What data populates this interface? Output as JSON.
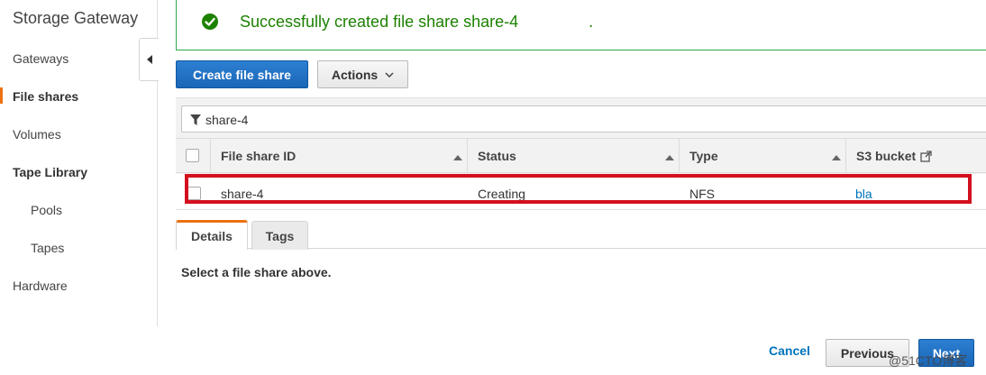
{
  "sidebar": {
    "title": "Storage Gateway",
    "items": [
      {
        "label": "Gateways"
      },
      {
        "label": "File shares"
      },
      {
        "label": "Volumes"
      },
      {
        "label": "Tape Library"
      },
      {
        "label": "Pools"
      },
      {
        "label": "Tapes"
      },
      {
        "label": "Hardware"
      }
    ],
    "active_item": "File shares"
  },
  "flash": {
    "message": "Successfully created file share share-4",
    "message_end": ".",
    "icon": "check-circle-icon",
    "color": "#1d8102"
  },
  "toolbar": {
    "create_label": "Create file share",
    "actions_label": "Actions"
  },
  "filter": {
    "value": "share-4",
    "icon": "filter-icon"
  },
  "table": {
    "columns": [
      "File share ID",
      "Status",
      "Type",
      "S3 bucket"
    ],
    "rows": [
      {
        "id": "share-4",
        "status": "Creating",
        "type": "NFS",
        "bucket": "bla"
      }
    ]
  },
  "tabs": [
    {
      "label": "Details",
      "active": true
    },
    {
      "label": "Tags",
      "active": false
    }
  ],
  "details": {
    "empty_text": "Select a file share above."
  },
  "footer": {
    "cancel_label": "Cancel",
    "previous_label": "Previous",
    "next_label": "Next"
  },
  "watermark": "@51CTO博客",
  "colors": {
    "primary": "#1a66b7",
    "accent": "#ec7211",
    "link": "#0073bb",
    "highlight": "#d40f1e"
  }
}
